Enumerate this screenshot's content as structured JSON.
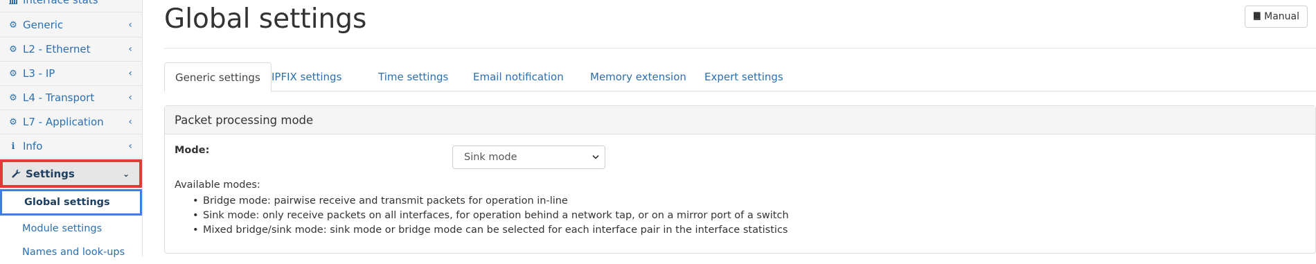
{
  "sidebar": {
    "items": [
      {
        "label": "Interface stats",
        "icon": "bar-chart-icon"
      },
      {
        "label": "Generic",
        "icon": "gear-icon"
      },
      {
        "label": "L2 - Ethernet",
        "icon": "gear-icon"
      },
      {
        "label": "L3 - IP",
        "icon": "gear-icon"
      },
      {
        "label": "L4 - Transport",
        "icon": "gear-icon"
      },
      {
        "label": "L7 - Application",
        "icon": "gear-icon"
      },
      {
        "label": "Info",
        "icon": "info-icon"
      },
      {
        "label": "Settings",
        "icon": "wrench-icon"
      }
    ],
    "sub_items": [
      {
        "label": "Global settings"
      },
      {
        "label": "Module settings"
      },
      {
        "label": "Names and look-ups"
      }
    ]
  },
  "header": {
    "title": "Global settings",
    "manual_label": "Manual"
  },
  "tabs": [
    {
      "label": "Generic settings"
    },
    {
      "label": "IPFIX settings"
    },
    {
      "label": "Time settings"
    },
    {
      "label": "Email notification"
    },
    {
      "label": "Memory extension"
    },
    {
      "label": "Expert settings"
    }
  ],
  "panel": {
    "title": "Packet processing mode",
    "mode_label": "Mode:",
    "mode_value": "Sink mode",
    "available_label": "Available modes:",
    "modes": [
      "Bridge mode: pairwise receive and transmit packets for operation in-line",
      "Sink mode: only receive packets on all interfaces, for operation behind a network tap, or on a mirror port of a switch",
      "Mixed bridge/sink mode: sink mode or bridge mode can be selected for each interface pair in the interface statistics"
    ]
  },
  "colors": {
    "link": "#2a6fb0",
    "highlight_red": "#e53935",
    "highlight_blue": "#3f7fe0"
  }
}
